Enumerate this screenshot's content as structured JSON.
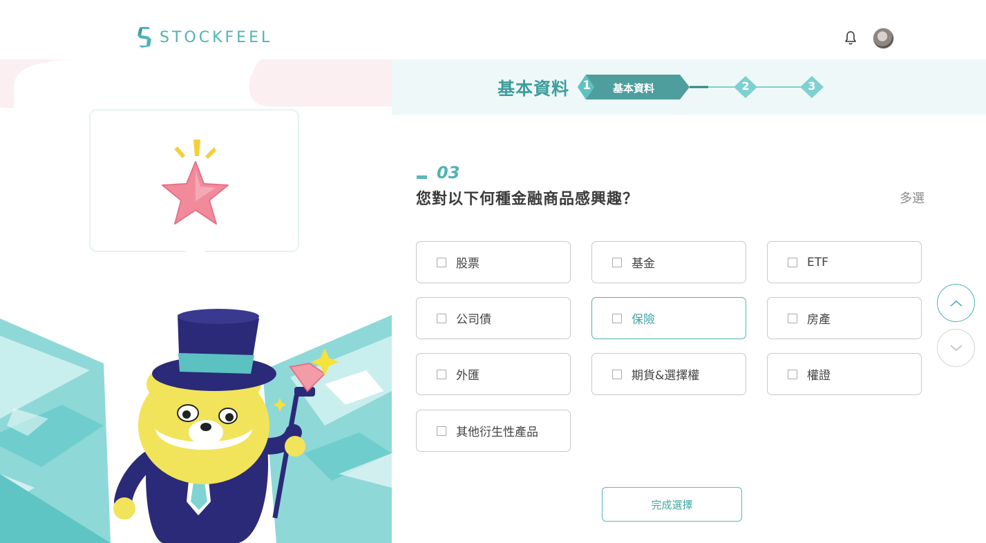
{
  "header": {
    "logo_text": "STOCKFEEL"
  },
  "stepper": {
    "section_title": "基本資料",
    "active_step_number": "1",
    "active_step_label": "基本資料",
    "step2_number": "2",
    "step3_number": "3"
  },
  "question": {
    "number": "03",
    "title": "您對以下何種金融商品感興趣？",
    "mode_label": "多選"
  },
  "options": [
    {
      "label": "股票",
      "selected": false
    },
    {
      "label": "基金",
      "selected": false
    },
    {
      "label": "ETF",
      "selected": false
    },
    {
      "label": "公司債",
      "selected": false
    },
    {
      "label": "保險",
      "selected": true
    },
    {
      "label": "房產",
      "selected": false
    },
    {
      "label": "外匯",
      "selected": false
    },
    {
      "label": "期貨&選擇權",
      "selected": false
    },
    {
      "label": "權證",
      "selected": false
    },
    {
      "label": "其他衍生性產品",
      "selected": false
    }
  ],
  "footer": {
    "done_button": "完成選擇"
  },
  "colors": {
    "accent": "#4fb3b3",
    "accent_dark": "#3f9c9c",
    "stepper_band": "#eef8f8",
    "mascot_yellow": "#f1e45a",
    "hat_navy": "#2b2a78",
    "star_pink": "#f08a9a"
  },
  "icons": {
    "bell": "bell-icon",
    "avatar": "avatar",
    "nav_up": "chevron-up-icon",
    "nav_down": "chevron-down-icon",
    "checkbox": "checkbox-icon"
  }
}
